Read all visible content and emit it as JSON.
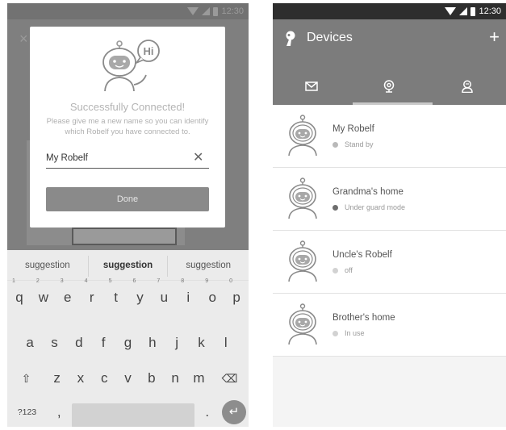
{
  "left_phone": {
    "status_time": "12:30",
    "background_close": "×",
    "dialog": {
      "bubble_text": "Hi",
      "title": "Successfully Connected!",
      "message": "Please give me a new name so you can identify which Robelf you have connected to.",
      "input_value": "My Robelf",
      "clear_glyph": "✕",
      "done_label": "Done"
    },
    "keyboard": {
      "suggestions": [
        "suggestion",
        "suggestion",
        "suggestion"
      ],
      "row1": [
        {
          "k": "q",
          "n": "1"
        },
        {
          "k": "w",
          "n": "2"
        },
        {
          "k": "e",
          "n": "3"
        },
        {
          "k": "r",
          "n": "4"
        },
        {
          "k": "t",
          "n": "5"
        },
        {
          "k": "y",
          "n": "6"
        },
        {
          "k": "u",
          "n": "7"
        },
        {
          "k": "i",
          "n": "8"
        },
        {
          "k": "o",
          "n": "9"
        },
        {
          "k": "p",
          "n": "0"
        }
      ],
      "row2": [
        "a",
        "s",
        "d",
        "f",
        "g",
        "h",
        "j",
        "k",
        "l"
      ],
      "row3": [
        "z",
        "x",
        "c",
        "v",
        "b",
        "n",
        "m"
      ],
      "shift_glyph": "⇧",
      "delete_glyph": "⌫",
      "symbols_label": "?123",
      "comma": ",",
      "period": ".",
      "enter_glyph": "↵"
    }
  },
  "right_phone": {
    "status_time": "12:30",
    "title": "Devices",
    "add_glyph": "+",
    "tabs": [
      {
        "name": "messages",
        "icon": "envelope-icon"
      },
      {
        "name": "devices",
        "icon": "webcam-icon",
        "active": true
      },
      {
        "name": "contacts",
        "icon": "person-icon"
      }
    ],
    "devices": [
      {
        "name": "My Robelf",
        "status": "Stand by",
        "status_color": "#b9b9b9"
      },
      {
        "name": "Grandma's home",
        "status": "Under guard mode",
        "status_color": "#6e6e6e"
      },
      {
        "name": "Uncle's Robelf",
        "status": "off",
        "status_color": "#d2d2d2"
      },
      {
        "name": "Brother's home",
        "status": "In use",
        "status_color": "#d2d2d2"
      }
    ]
  }
}
